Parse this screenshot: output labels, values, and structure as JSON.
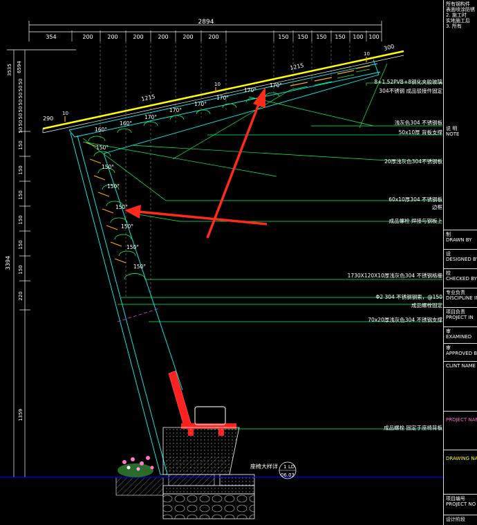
{
  "dimensions": {
    "total_width": "2894",
    "top_segments": [
      "354",
      "200",
      "200",
      "200",
      "200",
      "200",
      "200",
      "150",
      "150",
      "150",
      "150",
      "100"
    ],
    "top_right": "300",
    "total_height": "3394",
    "left_top_small": [
      "3535",
      "6594"
    ],
    "left_ticks": [
      "50",
      "50",
      "50",
      "50",
      "50",
      "50",
      "50",
      "50",
      "150",
      "150",
      "150",
      "150",
      "150",
      "150",
      "150",
      "150",
      "220",
      "1359"
    ],
    "glass_overhang": "290",
    "slope_1215_a": "1215",
    "slope_1215_b": "1215",
    "small_10": "10",
    "small_10_b": "10",
    "small_10_c": "10",
    "angles_top": [
      "170°",
      "170°",
      "170°",
      "170°",
      "170°",
      "170°",
      "160°",
      "160°"
    ],
    "angles_side": [
      "150°",
      "150°",
      "150°",
      "150°",
      "150°",
      "150°",
      "150°",
      "150°"
    ]
  },
  "annotations": [
    "8+1.52PVB+8钢化夹胶玻璃",
    "304不锈钢 成品驳接件固定",
    "浅灰色304 不锈钢板",
    "50x10厚 背板支撑",
    "20厚浅灰色304不锈钢板",
    "60x10厚304 不锈钢板",
    "边框",
    "成品螺栓 焊接与钢板上",
    "1730X120X10厚浅灰色304 不锈钢格栅",
    "Φ2 304 不锈钢钢索，@150",
    "成品螺栓固定",
    "70x20厚浅灰色304 不锈钢支撑",
    "成品螺栓 固定于座椅背板"
  ],
  "detail_ref": {
    "label": "座椅大样详",
    "number": "1",
    "sheet_top": "LD",
    "sheet_bottom": "06.03"
  },
  "notes": {
    "header": [
      "所有钢构件",
      "表面喷涂防锈",
      "2.  施工时",
      "实地施工后",
      "3.  所有"
    ]
  },
  "title_block": [
    {
      "cn": "说 明",
      "en": "NOTE"
    },
    {
      "cn": "制",
      "en": "DRAWN BY"
    },
    {
      "cn": "设",
      "en": "DESIGNED BY"
    },
    {
      "cn": "校",
      "en": "CHECKED BY"
    },
    {
      "cn": "专业负责",
      "en": "DISCIPLINE IN"
    },
    {
      "cn": "项目负责",
      "en": "PROJECT IN"
    },
    {
      "cn": "审",
      "en": "EXAMINED"
    },
    {
      "cn": "审",
      "en": "APPROVED BY"
    },
    {
      "cn": "",
      "en": "CLINT NAME"
    },
    {
      "cn": "",
      "en": "PROJECT NAME"
    },
    {
      "cn": "",
      "en": "DRAWING NAME"
    },
    {
      "cn": "项目编号",
      "en": "PROJECT NO"
    },
    {
      "cn": "设计阶段",
      "en": ""
    }
  ],
  "colors": {
    "background": "#000000",
    "glass": "#ffff00",
    "steel": "#00ffff",
    "leader": "#00ff00",
    "dimension": "#ffffff",
    "bench": "#ff2020",
    "ground": "#0000ff",
    "arrow": "#ff2a1a"
  }
}
